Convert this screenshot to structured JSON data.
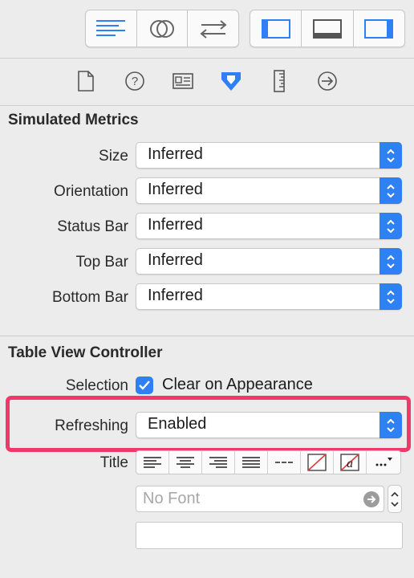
{
  "toolbar": {
    "left_group": [
      "standard-editor-icon",
      "assistant-editor-icon",
      "version-editor-icon"
    ],
    "right_group": [
      "navigator-toggle-icon",
      "debug-area-toggle-icon",
      "utilities-toggle-icon"
    ],
    "accent": "#2f80f5"
  },
  "inspector_tabs": [
    "file-inspector-icon",
    "quick-help-icon",
    "identity-inspector-icon",
    "attributes-inspector-icon",
    "size-inspector-icon",
    "connections-inspector-icon"
  ],
  "simulated_metrics": {
    "title": "Simulated Metrics",
    "rows": [
      {
        "label": "Size",
        "value": "Inferred"
      },
      {
        "label": "Orientation",
        "value": "Inferred"
      },
      {
        "label": "Status Bar",
        "value": "Inferred"
      },
      {
        "label": "Top Bar",
        "value": "Inferred"
      },
      {
        "label": "Bottom Bar",
        "value": "Inferred"
      }
    ]
  },
  "table_view_controller": {
    "title": "Table View Controller",
    "selection_label": "Selection",
    "selection_checkbox_label": "Clear on Appearance",
    "selection_checked": true,
    "refreshing_label": "Refreshing",
    "refreshing_value": "Enabled",
    "highlight_color": "#f0386b",
    "title_label": "Title",
    "font_placeholder": "No Font",
    "title_text": ""
  }
}
